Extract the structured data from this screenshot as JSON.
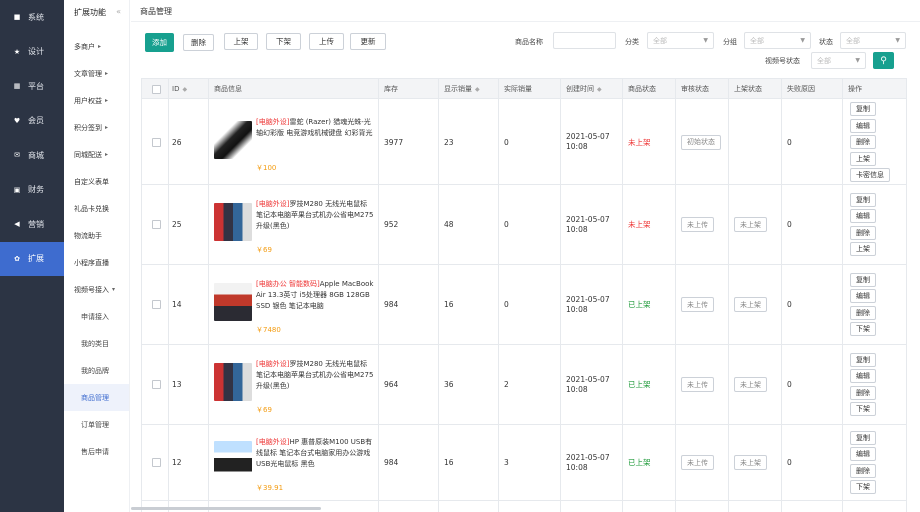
{
  "sidebar": {
    "items": [
      {
        "label": "系统",
        "icon": "monitor-icon",
        "glyph": "■"
      },
      {
        "label": "设计",
        "icon": "pin-icon",
        "glyph": "★"
      },
      {
        "label": "平台",
        "icon": "grid-icon",
        "glyph": "▦"
      },
      {
        "label": "会员",
        "icon": "heart-icon",
        "glyph": "♥"
      },
      {
        "label": "商城",
        "icon": "mail-icon",
        "glyph": "✉"
      },
      {
        "label": "财务",
        "icon": "wallet-icon",
        "glyph": "▣"
      },
      {
        "label": "营销",
        "icon": "megaphone-icon",
        "glyph": "◀"
      },
      {
        "label": "扩展",
        "icon": "gear-icon",
        "glyph": "✿"
      }
    ],
    "active_index": 7
  },
  "subnav": {
    "title": "扩展功能",
    "collapse": "«",
    "items": [
      {
        "label": "多商户",
        "chev": "▸"
      },
      {
        "label": "文章管理",
        "chev": "▸"
      },
      {
        "label": "用户权益",
        "chev": "▸"
      },
      {
        "label": "积分签到",
        "chev": "▸"
      },
      {
        "label": "同城配送",
        "chev": "▸"
      },
      {
        "label": "自定义表单",
        "chev": ""
      },
      {
        "label": "礼品卡兑换",
        "chev": ""
      },
      {
        "label": "物流助手",
        "chev": ""
      },
      {
        "label": "小程序直播",
        "chev": ""
      },
      {
        "label": "视频号接入",
        "chev": "▾"
      }
    ],
    "children": [
      {
        "label": "申请接入"
      },
      {
        "label": "我的类目"
      },
      {
        "label": "我的品牌"
      },
      {
        "label": "商品管理"
      },
      {
        "label": "订单管理"
      },
      {
        "label": "售后申请"
      }
    ],
    "active_child": 3
  },
  "page": {
    "title": "商品管理"
  },
  "toolbar": {
    "add": "添加",
    "delete": "删除",
    "list_on": "上架",
    "list_off": "下架",
    "upload": "上传",
    "update": "更新"
  },
  "filters": {
    "name_label": "商品名称",
    "category_label": "分类",
    "category_value": "全部",
    "group_label": "分组",
    "group_value": "全部",
    "state_label": "状态",
    "state_value": "全部",
    "video_state_label": "视频号状态",
    "video_state_value": "全部",
    "search_glyph": "⚲"
  },
  "table": {
    "headers": {
      "id": "ID",
      "info": "商品信息",
      "stock": "库存",
      "sales_shown": "显示销量",
      "sales_real": "实际销量",
      "created": "创建时间",
      "status": "商品状态",
      "audit": "审核状态",
      "listing": "上架状态",
      "reject": "失败原因",
      "ops": "操作"
    },
    "rows": [
      {
        "id": "26",
        "tag": "[电脑外设]",
        "name": "雷蛇 (Razer) 猎魂光蛛-光轴幻彩版 电竞游戏机械键盘 幻彩背光",
        "price": "￥100",
        "stock": "3977",
        "sales_shown": "23",
        "sales_real": "0",
        "created": "2021-05-07 10:08",
        "status": "未上架",
        "status_kind": "off",
        "audit": "初始状态",
        "listing": "",
        "reject": "0",
        "ops": [
          "复制",
          "编辑",
          "删除",
          "上架",
          "卡密信息"
        ]
      },
      {
        "id": "25",
        "tag": "[电脑外设]",
        "name": "罗技M280 无线光电鼠标笔记本电脑苹果台式机办公省电M275升级(黑色)",
        "price": "￥69",
        "stock": "952",
        "sales_shown": "48",
        "sales_real": "0",
        "created": "2021-05-07 10:08",
        "status": "未上架",
        "status_kind": "off",
        "audit": "未上传",
        "listing": "未上架",
        "reject": "0",
        "ops": [
          "复制",
          "编辑",
          "删除",
          "上架"
        ]
      },
      {
        "id": "14",
        "tag": "[电脑办公 智能数码]",
        "name": "Apple MacBook Air 13.3英寸 i5处理器 8GB 128GB SSD 银色 笔记本电脑",
        "price": "￥7480",
        "stock": "984",
        "sales_shown": "16",
        "sales_real": "0",
        "created": "2021-05-07 10:08",
        "status": "已上架",
        "status_kind": "on",
        "audit": "未上传",
        "listing": "未上架",
        "reject": "0",
        "ops": [
          "复制",
          "编辑",
          "删除",
          "下架"
        ]
      },
      {
        "id": "13",
        "tag": "[电脑外设]",
        "name": "罗技M280 无线光电鼠标笔记本电脑苹果台式机办公省电M275升级(黑色)",
        "price": "￥69",
        "stock": "964",
        "sales_shown": "36",
        "sales_real": "2",
        "created": "2021-05-07 10:08",
        "status": "已上架",
        "status_kind": "on",
        "audit": "未上传",
        "listing": "未上架",
        "reject": "0",
        "ops": [
          "复制",
          "编辑",
          "删除",
          "下架"
        ]
      },
      {
        "id": "12",
        "tag": "[电脑外设]",
        "name": "HP 惠普原装M100 USB有线鼠标 笔记本台式电脑家用办公游戏USB光电鼠标 黑色",
        "price": "￥39.91",
        "stock": "984",
        "sales_shown": "16",
        "sales_real": "3",
        "created": "2021-05-07 10:08",
        "status": "已上架",
        "status_kind": "on",
        "audit": "未上传",
        "listing": "未上架",
        "reject": "0",
        "ops": [
          "复制",
          "编辑",
          "删除",
          "下架"
        ]
      }
    ]
  },
  "colors": {
    "accent": "#17a08f",
    "sidebar": "#2c3444",
    "active": "#3e6ccf",
    "off": "#e33333",
    "on": "#1f9a3a",
    "price": "#f39c12"
  }
}
